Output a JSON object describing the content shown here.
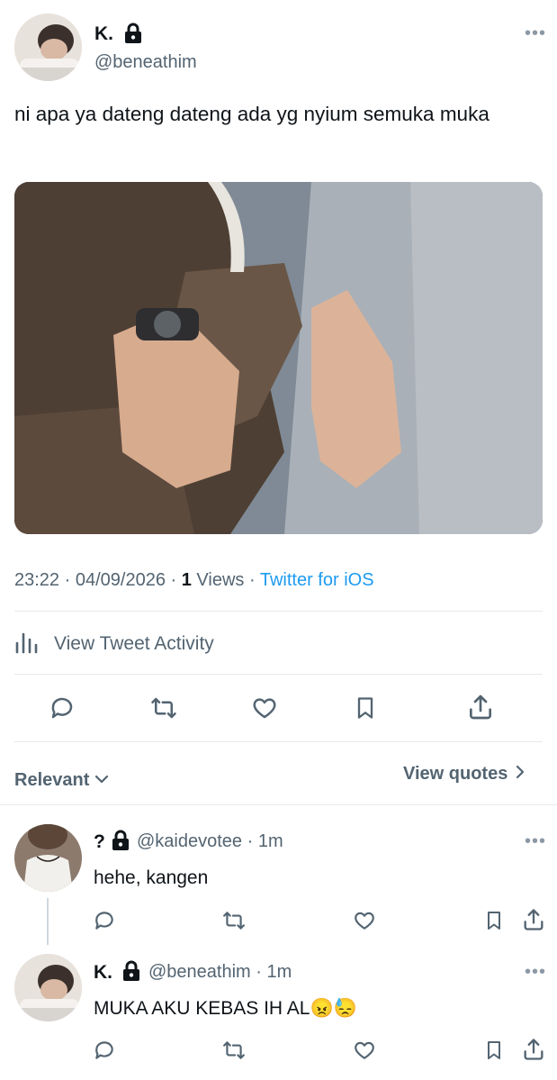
{
  "tweet": {
    "author_name": "K.",
    "author_handle": "@beneathim",
    "text": "ni apa ya dateng dateng ada yg nyium semuka muka",
    "time": "23:22",
    "date": "04/09/2026",
    "views_count": "1",
    "views_label": "Views",
    "source": "Twitter for iOS",
    "activity_label": "View Tweet Activity"
  },
  "replies_header": {
    "sort_label": "Relevant",
    "quotes_label": "View quotes"
  },
  "replies": [
    {
      "name": "?",
      "handle": "@kaidevotee",
      "time": "1m",
      "text": "hehe, kangen"
    },
    {
      "name": "K.",
      "handle": "@beneathim",
      "time": "1m",
      "text": "MUKA AKU KEBAS IH AL",
      "emojis": "😠😓"
    }
  ],
  "icons": {
    "lock": "lock-icon",
    "more": "more-icon",
    "reply": "reply-icon",
    "retweet": "retweet-icon",
    "like": "heart-icon",
    "bookmark": "bookmark-icon",
    "share": "share-icon",
    "activity": "bar-chart-icon",
    "chevron": "chevron-icon"
  },
  "colors": {
    "link": "#1d9bf0",
    "secondary_text": "#536471",
    "primary_text": "#0f1419"
  }
}
